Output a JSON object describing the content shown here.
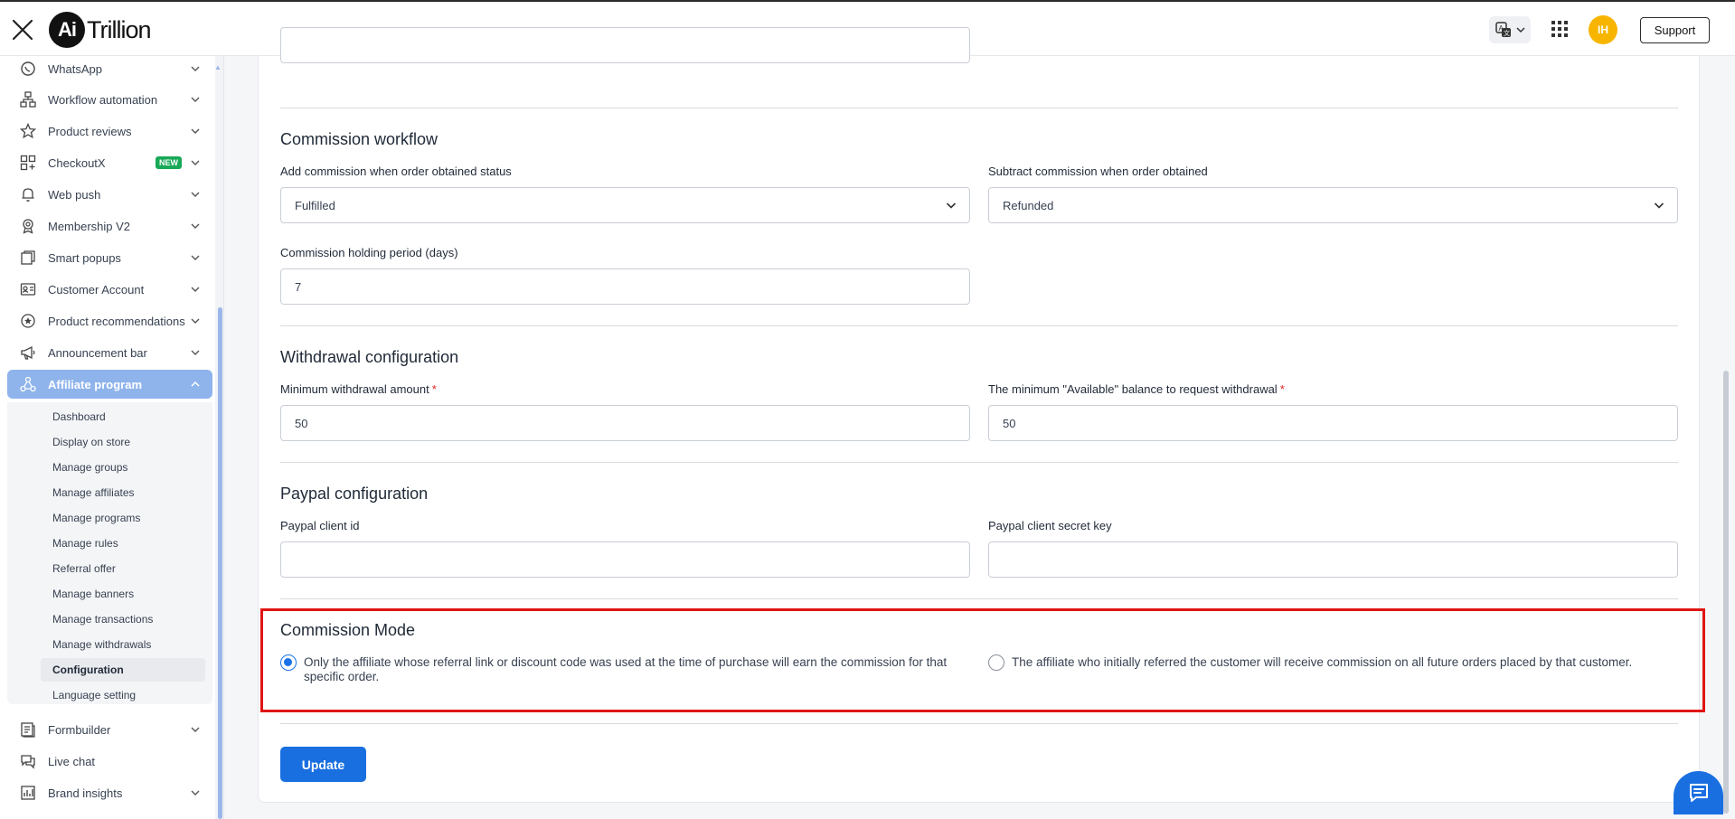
{
  "header": {
    "logo_ai": "Ai",
    "logo_text": "Trillion",
    "avatar_initials": "IH",
    "support_label": "Support"
  },
  "sidebar": {
    "items": [
      {
        "label": "WhatsApp",
        "icon": "whatsapp-icon"
      },
      {
        "label": "Workflow automation",
        "icon": "workflow-icon"
      },
      {
        "label": "Product reviews",
        "icon": "star-icon"
      },
      {
        "label": "CheckoutX",
        "icon": "checkout-icon",
        "badge": "NEW"
      },
      {
        "label": "Web push",
        "icon": "bell-icon"
      },
      {
        "label": "Membership V2",
        "icon": "membership-icon"
      },
      {
        "label": "Smart popups",
        "icon": "popup-icon"
      },
      {
        "label": "Customer Account",
        "icon": "id-card-icon"
      },
      {
        "label": "Product recommendations",
        "icon": "recommendation-icon"
      },
      {
        "label": "Announcement bar",
        "icon": "megaphone-icon"
      },
      {
        "label": "Affiliate program",
        "icon": "affiliate-icon",
        "active": true
      },
      {
        "label": "Formbuilder",
        "icon": "form-icon"
      },
      {
        "label": "Live chat",
        "icon": "chat-icon"
      },
      {
        "label": "Brand insights",
        "icon": "insights-icon"
      }
    ],
    "affiliate_sub_items": [
      {
        "label": "Dashboard"
      },
      {
        "label": "Display on store"
      },
      {
        "label": "Manage groups"
      },
      {
        "label": "Manage affiliates"
      },
      {
        "label": "Manage programs"
      },
      {
        "label": "Manage rules"
      },
      {
        "label": "Referral offer"
      },
      {
        "label": "Manage banners"
      },
      {
        "label": "Manage transactions"
      },
      {
        "label": "Manage withdrawals"
      },
      {
        "label": "Configuration",
        "active": true
      },
      {
        "label": "Language setting"
      }
    ]
  },
  "commission_workflow": {
    "title": "Commission workflow",
    "add_label": "Add commission when order obtained status",
    "add_value": "Fulfilled",
    "subtract_label": "Subtract commission when order obtained",
    "subtract_value": "Refunded",
    "holding_label": "Commission holding period (days)",
    "holding_value": "7"
  },
  "withdrawal_configuration": {
    "title": "Withdrawal configuration",
    "min_amount_label": "Minimum withdrawal amount",
    "min_amount_value": "50",
    "min_balance_label": "The minimum \"Available\" balance to request withdrawal",
    "min_balance_value": "50",
    "required_mark": "*"
  },
  "paypal_configuration": {
    "title": "Paypal configuration",
    "client_id_label": "Paypal client id",
    "client_id_value": "",
    "secret_label": "Paypal client secret key",
    "secret_value": ""
  },
  "commission_mode": {
    "title": "Commission Mode",
    "option_1": "Only the affiliate whose referral link or discount code was used at the time of purchase will earn the commission for that specific order.",
    "option_2": "The affiliate who initially referred the customer will receive commission on all future orders placed by that customer.",
    "selected": 1
  },
  "actions": {
    "update_label": "Update"
  },
  "colors": {
    "primary": "#1a6fe0",
    "sidebar_active": "#8fb4ec",
    "highlight_border": "#e01515",
    "badge_new": "#18a957",
    "avatar": "#f7b500"
  }
}
